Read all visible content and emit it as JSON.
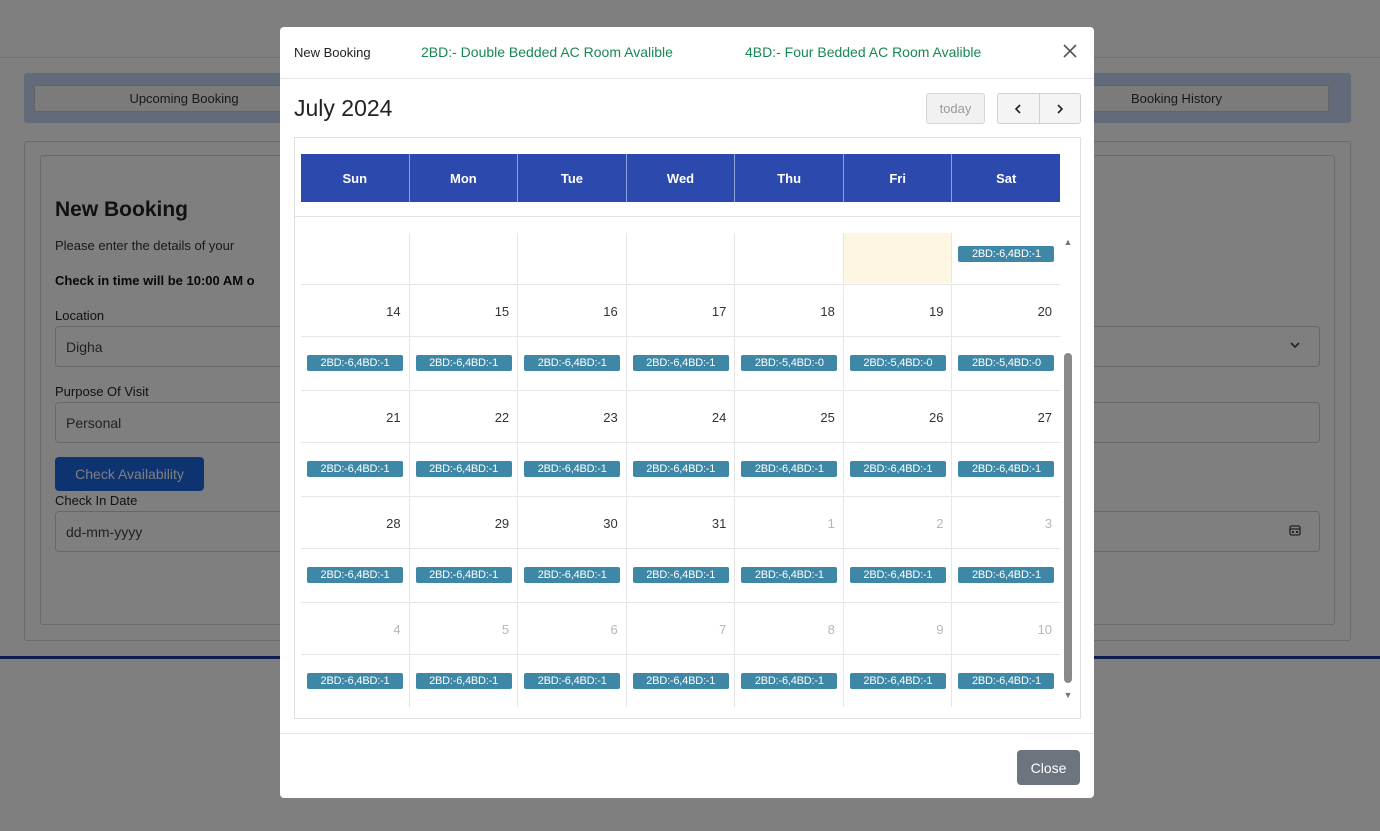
{
  "background": {
    "tabs": {
      "upcoming": "Upcoming Booking",
      "history": "Booking History"
    },
    "form": {
      "title": "New Booking",
      "description": "Please enter the details of your",
      "checkin_note": "Check in time will be 10:00 AM o",
      "location_label": "Location",
      "location_value": "Digha",
      "purpose_label": "Purpose Of Visit",
      "purpose_value": "Personal",
      "check_button": "Check Availability",
      "checkin_date_label": "Check In Date",
      "checkin_date_placeholder": "dd-mm-yyyy"
    },
    "icons": {
      "dropdown": "chevron-down-icon",
      "date": "calendar-icon"
    }
  },
  "modal": {
    "title": "New Booking",
    "legend_2bd": "2BD:- Double Bedded AC Room Avalible",
    "legend_4bd": "4BD:- Four Bedded AC Room Avalible",
    "close_x": "×",
    "close_button": "Close"
  },
  "calendar": {
    "title": "July 2024",
    "today_button": "today",
    "prev_button": "<",
    "next_button": ">",
    "headers": [
      "Sun",
      "Mon",
      "Tue",
      "Wed",
      "Thu",
      "Fri",
      "Sat"
    ],
    "accent": "#2c49ad",
    "badge_color": "#3f87a6",
    "partial_week": {
      "days": [
        {
          "num": "",
          "badge": ""
        },
        {
          "num": "",
          "badge": ""
        },
        {
          "num": "",
          "badge": ""
        },
        {
          "num": "",
          "badge": ""
        },
        {
          "num": "",
          "badge": ""
        },
        {
          "num": "",
          "badge": "",
          "today": true
        },
        {
          "num": "",
          "badge": "2BD:-6,4BD:-1"
        }
      ]
    },
    "weeks": [
      {
        "days": [
          {
            "num": "14",
            "badge": "2BD:-6,4BD:-1"
          },
          {
            "num": "15",
            "badge": "2BD:-6,4BD:-1"
          },
          {
            "num": "16",
            "badge": "2BD:-6,4BD:-1"
          },
          {
            "num": "17",
            "badge": "2BD:-6,4BD:-1"
          },
          {
            "num": "18",
            "badge": "2BD:-5,4BD:-0"
          },
          {
            "num": "19",
            "badge": "2BD:-5,4BD:-0"
          },
          {
            "num": "20",
            "badge": "2BD:-5,4BD:-0"
          }
        ]
      },
      {
        "days": [
          {
            "num": "21",
            "badge": "2BD:-6,4BD:-1"
          },
          {
            "num": "22",
            "badge": "2BD:-6,4BD:-1"
          },
          {
            "num": "23",
            "badge": "2BD:-6,4BD:-1"
          },
          {
            "num": "24",
            "badge": "2BD:-6,4BD:-1"
          },
          {
            "num": "25",
            "badge": "2BD:-6,4BD:-1"
          },
          {
            "num": "26",
            "badge": "2BD:-6,4BD:-1"
          },
          {
            "num": "27",
            "badge": "2BD:-6,4BD:-1"
          }
        ]
      },
      {
        "days": [
          {
            "num": "28",
            "badge": "2BD:-6,4BD:-1"
          },
          {
            "num": "29",
            "badge": "2BD:-6,4BD:-1"
          },
          {
            "num": "30",
            "badge": "2BD:-6,4BD:-1"
          },
          {
            "num": "31",
            "badge": "2BD:-6,4BD:-1"
          },
          {
            "num": "1",
            "badge": "2BD:-6,4BD:-1",
            "other": true
          },
          {
            "num": "2",
            "badge": "2BD:-6,4BD:-1",
            "other": true
          },
          {
            "num": "3",
            "badge": "2BD:-6,4BD:-1",
            "other": true
          }
        ]
      },
      {
        "days": [
          {
            "num": "4",
            "badge": "2BD:-6,4BD:-1",
            "other": true
          },
          {
            "num": "5",
            "badge": "2BD:-6,4BD:-1",
            "other": true
          },
          {
            "num": "6",
            "badge": "2BD:-6,4BD:-1",
            "other": true
          },
          {
            "num": "7",
            "badge": "2BD:-6,4BD:-1",
            "other": true
          },
          {
            "num": "8",
            "badge": "2BD:-6,4BD:-1",
            "other": true
          },
          {
            "num": "9",
            "badge": "2BD:-6,4BD:-1",
            "other": true
          },
          {
            "num": "10",
            "badge": "2BD:-6,4BD:-1",
            "other": true
          }
        ]
      }
    ]
  }
}
